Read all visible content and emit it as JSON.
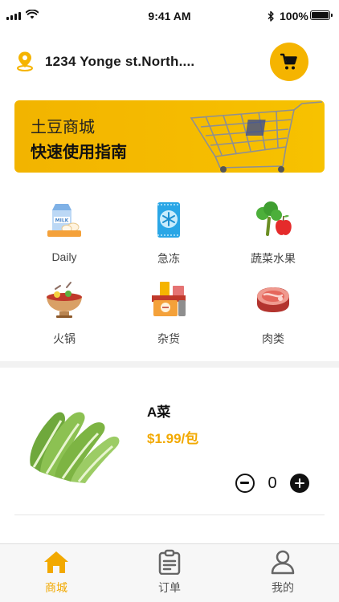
{
  "status_bar": {
    "time": "9:41 AM",
    "battery": "100%"
  },
  "header": {
    "address": "1234 Yonge st.North...."
  },
  "banner": {
    "line1": "土豆商城",
    "line2": "快速使用指南"
  },
  "categories": [
    {
      "label": "Daily",
      "icon": "milk-eggs-icon"
    },
    {
      "label": "急冻",
      "icon": "frozen-food-icon"
    },
    {
      "label": "蔬菜水果",
      "icon": "vegetables-fruit-icon"
    },
    {
      "label": "火锅",
      "icon": "hotpot-icon"
    },
    {
      "label": "杂货",
      "icon": "groceries-icon"
    },
    {
      "label": "肉类",
      "icon": "meat-icon"
    }
  ],
  "product": {
    "name": "A菜",
    "price": "$1.99/包",
    "quantity": "0"
  },
  "tabs": [
    {
      "label": "商城",
      "icon": "home-icon",
      "active": true
    },
    {
      "label": "订单",
      "icon": "orders-icon",
      "active": false
    },
    {
      "label": "我的",
      "icon": "profile-icon",
      "active": false
    }
  ],
  "colors": {
    "accent": "#f5b400",
    "price": "#f2a900",
    "separator": "#f2f2f2"
  }
}
